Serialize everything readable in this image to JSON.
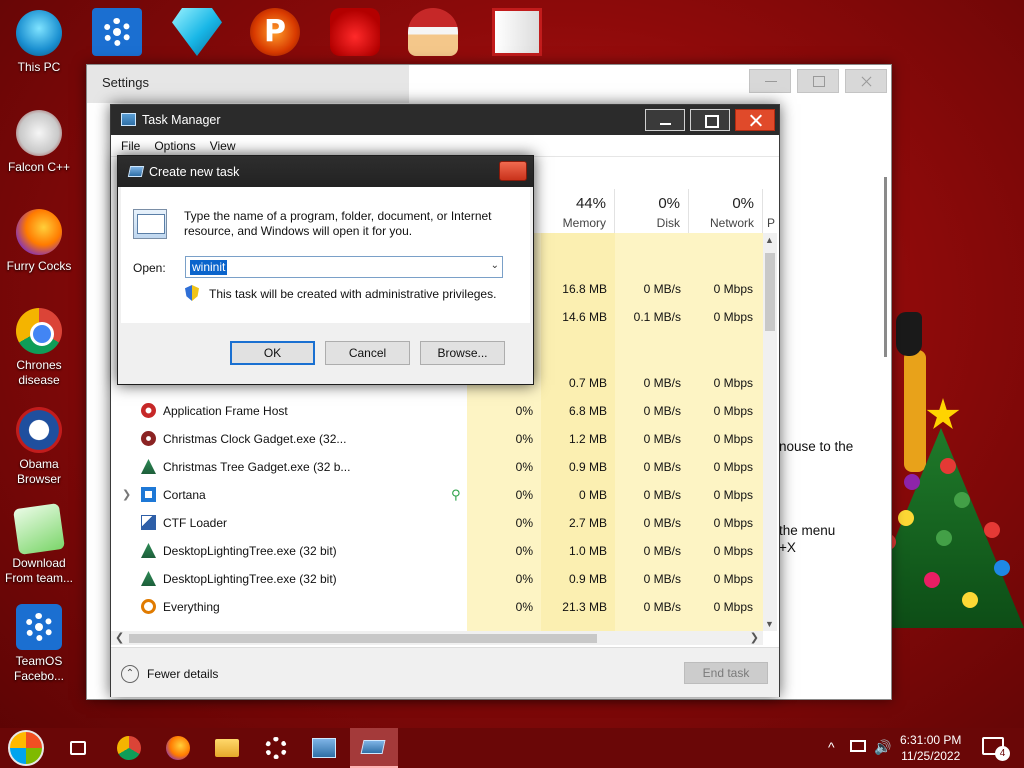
{
  "desktop": {
    "left_icons": [
      {
        "label": "This PC",
        "icon": "this-pc-icon"
      },
      {
        "label": "Falcon C++",
        "icon": "falcon-icon"
      },
      {
        "label": "Furry Cocks",
        "icon": "firefox-icon"
      },
      {
        "label": "Chrones disease",
        "icon": "chrome-icon"
      },
      {
        "label": "Obama Browser",
        "icon": "obama-icon"
      },
      {
        "label": "Download From team...",
        "icon": "notepad-icon"
      },
      {
        "label": "TeamOS Facebo...",
        "icon": "gear-icon"
      }
    ],
    "top_icons": [
      "gear-icon",
      "diamond-icon",
      "p-badge-icon",
      "angry-bird-icon",
      "santa-icon",
      "door-icon"
    ],
    "top_icon_p": "P"
  },
  "settings": {
    "title": "Settings",
    "partial_text_1": "nouse to the",
    "partial_text_2": "the menu",
    "partial_text_3": "+X"
  },
  "task_manager": {
    "title": "Task Manager",
    "menu": [
      "File",
      "Options",
      "View"
    ],
    "columns": {
      "memory": {
        "pct": "44%",
        "label": "Memory"
      },
      "disk": {
        "pct": "0%",
        "label": "Disk"
      },
      "network": {
        "pct": "0%",
        "label": "Network"
      },
      "p_label": "P"
    },
    "partial_rows": [
      {
        "memory": "16.8 MB",
        "disk": "0 MB/s",
        "network": "0 Mbps"
      },
      {
        "memory": "14.6 MB",
        "disk": "0.1 MB/s",
        "network": "0 Mbps"
      },
      {
        "memory": "0.7 MB",
        "disk": "0 MB/s",
        "network": "0 Mbps"
      }
    ],
    "processes": [
      {
        "name": "Application Frame Host",
        "cpu": "0%",
        "memory": "6.8 MB",
        "disk": "0 MB/s",
        "network": "0 Mbps"
      },
      {
        "name": "Christmas Clock Gadget.exe (32...",
        "cpu": "0%",
        "memory": "1.2 MB",
        "disk": "0 MB/s",
        "network": "0 Mbps"
      },
      {
        "name": "Christmas Tree Gadget.exe (32 b...",
        "cpu": "0%",
        "memory": "0.9 MB",
        "disk": "0 MB/s",
        "network": "0 Mbps"
      },
      {
        "name": "Cortana",
        "cpu": "0%",
        "memory": "0 MB",
        "disk": "0 MB/s",
        "network": "0 Mbps"
      },
      {
        "name": "CTF Loader",
        "cpu": "0%",
        "memory": "2.7 MB",
        "disk": "0 MB/s",
        "network": "0 Mbps"
      },
      {
        "name": "DesktopLightingTree.exe (32 bit)",
        "cpu": "0%",
        "memory": "1.0 MB",
        "disk": "0 MB/s",
        "network": "0 Mbps"
      },
      {
        "name": "DesktopLightingTree.exe (32 bit)",
        "cpu": "0%",
        "memory": "0.9 MB",
        "disk": "0 MB/s",
        "network": "0 Mbps"
      },
      {
        "name": "Everything",
        "cpu": "0%",
        "memory": "21.3 MB",
        "disk": "0 MB/s",
        "network": "0 Mbps"
      }
    ],
    "fewer_details": "Fewer details",
    "end_task": "End task"
  },
  "run_dialog": {
    "title": "Create new task",
    "message": "Type the name of a program, folder, document, or Internet resource, and Windows will open it for you.",
    "open_label": "Open:",
    "open_value": "wininit",
    "admin_note": "This task will be created with administrative privileges.",
    "ok": "OK",
    "cancel": "Cancel",
    "browse": "Browse..."
  },
  "taskbar": {
    "time": "6:31:00 PM",
    "date": "11/25/2022",
    "notification_count": "4",
    "tray_glyphs": {
      "chevron": "^",
      "speaker": "🔊"
    }
  },
  "colors": {
    "wallpaper": "#a81212",
    "taskbar": "#6a0707",
    "cpu_highlight": "#fdf4c4",
    "selection": "#0a64cc"
  }
}
